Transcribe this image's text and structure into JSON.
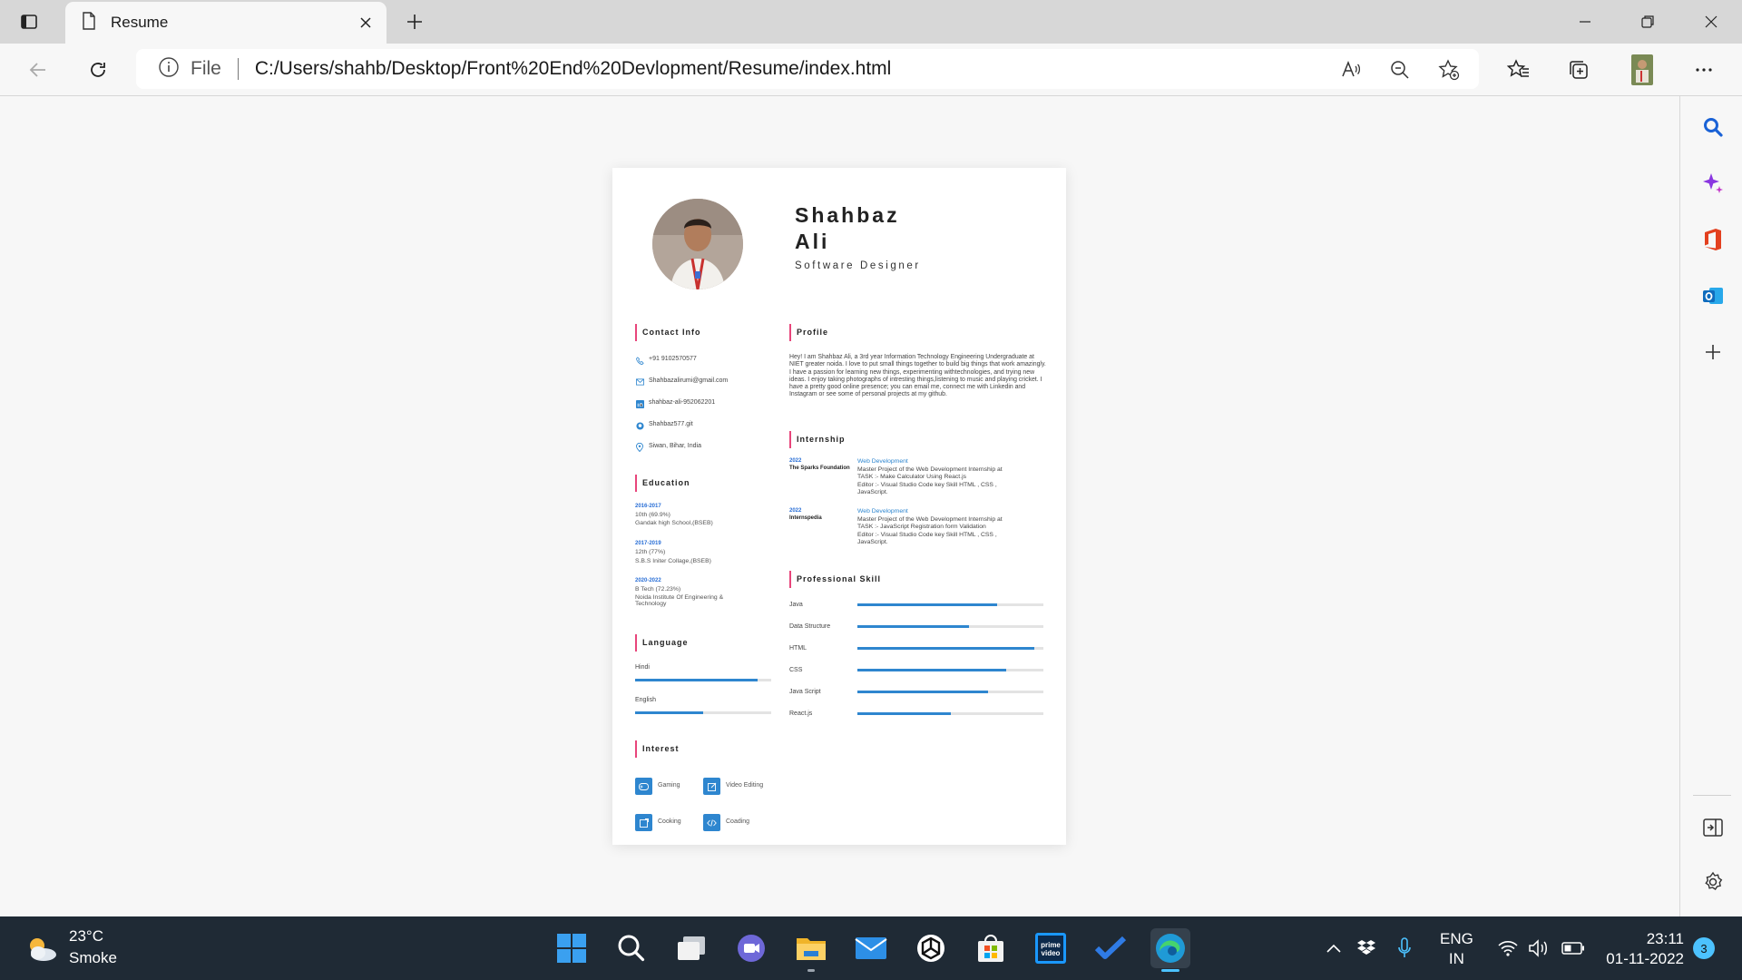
{
  "browser": {
    "tab_title": "Resume",
    "url_scheme_label": "File",
    "url": "C:/Users/shahb/Desktop/Front%20End%20Devlopment/Resume/index.html"
  },
  "resume": {
    "first_name": "Shahbaz",
    "last_name": "Ali",
    "role": "Software Designer",
    "sections": {
      "contact": "Contact Info",
      "education": "Education",
      "language": "Language",
      "interest": "Interest",
      "profile": "Profile",
      "internship": "Internship",
      "skills": "Professional Skill"
    },
    "contact": {
      "phone": "+91 9102570577",
      "email": "Shahbazalirumi@gmail.com",
      "linkedin": "shahbaz-ali-952062201",
      "github": "Shahbaz577.git",
      "location": "Siwan, Bihar, India"
    },
    "education": [
      {
        "years": "2016-2017",
        "line1": "10th (69.9%)",
        "line2": "Gandak high School,(BSEB)",
        "line3": ""
      },
      {
        "years": "2017-2019",
        "line1": "12th (77%)",
        "line2": "S.B.S Initer Collage,(BSEB)",
        "line3": ""
      },
      {
        "years": "2020-2022",
        "line1": "B Tech (72.23%)",
        "line2": "Noida Institute Of Engineering &",
        "line3": "Technology"
      }
    ],
    "languages": [
      {
        "name": "Hindi",
        "level": 0.9
      },
      {
        "name": "English",
        "level": 0.5
      }
    ],
    "interests": {
      "gaming": "Gaming",
      "video": "Video Editing",
      "cooking": "Cooking",
      "coding": "Coading"
    },
    "profile": "Hey! I am Shahbaz Ali, a 3rd year Information Technology Engineering Undergraduate at NIET greater noida. I love to put small things together to build big things that work amazingly. I have a passion for learning new things, experimenting withtechnologies, and trying new ideas. I enjoy taking photographs of intresting things,listening to music and playing cricket. I have a pretty good online presence; you can email me, connect me with Linkedin and Instagram or see some of personal projects at my github.",
    "internships": [
      {
        "year": "2022",
        "org": "The Sparks Foundation",
        "role": "Web Development",
        "d1": "Master Project of the Web Development Internship at",
        "d2": "TASK :- Make Calculator Using React.js",
        "d3": "Editor :- Visual Studio Code key Skill HTML , CSS ,",
        "d4": "JavaScript."
      },
      {
        "year": "2022",
        "org": "Internspedia",
        "role": "Web Development",
        "d1": "Master Project of the Web Development Internship at",
        "d2": "TASK :- JavaScript Registration form Validation",
        "d3": "Editor :- Visual Studio Code key Skill HTML , CSS ,",
        "d4": "JavaScript."
      }
    ],
    "skills": [
      {
        "name": "Java",
        "level": 0.75
      },
      {
        "name": "Data Structure",
        "level": 0.6
      },
      {
        "name": "HTML",
        "level": 0.95
      },
      {
        "name": "CSS",
        "level": 0.8
      },
      {
        "name": "Java Script",
        "level": 0.7
      },
      {
        "name": "React.js",
        "level": 0.5
      }
    ]
  },
  "taskbar": {
    "temperature": "23°C",
    "condition": "Smoke",
    "lang1": "ENG",
    "lang2": "IN",
    "time": "23:11",
    "date": "01-11-2022",
    "notifications": "3"
  }
}
